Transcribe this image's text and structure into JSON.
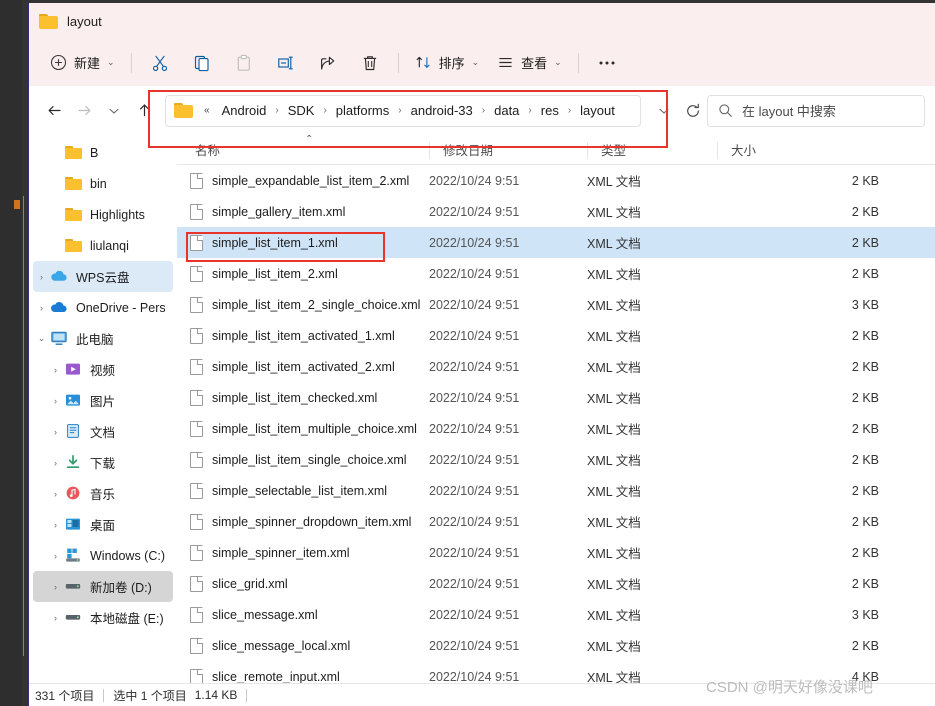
{
  "window": {
    "title": "layout",
    "folder_icon": "folder-icon"
  },
  "toolbar": {
    "new_label": "新建",
    "sort_label": "排序",
    "view_label": "查看",
    "more_label": "…",
    "icons": [
      {
        "name": "cut-icon",
        "label": "剪切"
      },
      {
        "name": "copy-icon",
        "label": "复制"
      },
      {
        "name": "paste-icon",
        "label": "粘贴"
      },
      {
        "name": "rename-icon",
        "label": "重命名"
      },
      {
        "name": "share-icon",
        "label": "共享"
      },
      {
        "name": "delete-icon",
        "label": "删除"
      }
    ]
  },
  "nav": {
    "back": "back-icon",
    "forward": "forward-icon",
    "recent": "chevron-down-icon",
    "up": "up-icon",
    "refresh": "refresh-icon"
  },
  "address": {
    "overflow": "«",
    "crumbs": [
      "Android",
      "SDK",
      "platforms",
      "android-33",
      "data",
      "res",
      "layout"
    ],
    "separator": "›"
  },
  "search": {
    "placeholder": "在 layout 中搜索",
    "icon": "search-icon"
  },
  "sidebar": {
    "items": [
      {
        "label": "B",
        "icon": "folder-icon",
        "twisty": "",
        "indent": 1,
        "state": "none"
      },
      {
        "label": "bin",
        "icon": "folder-icon",
        "twisty": "",
        "indent": 1,
        "state": "none"
      },
      {
        "label": "Highlights",
        "icon": "folder-icon",
        "twisty": "",
        "indent": 1,
        "state": "none"
      },
      {
        "label": "liulanqi",
        "icon": "folder-icon",
        "twisty": "",
        "indent": 1,
        "state": "none"
      },
      {
        "label": "WPS云盘",
        "icon": "wps-cloud-icon",
        "twisty": "›",
        "indent": 0,
        "state": "blue"
      },
      {
        "label": "OneDrive - Pers",
        "icon": "onedrive-icon",
        "twisty": "›",
        "indent": 0,
        "state": "none"
      },
      {
        "label": "此电脑",
        "icon": "this-pc-icon",
        "twisty": "⌄",
        "indent": 0,
        "state": "none"
      },
      {
        "label": "视频",
        "icon": "videos-icon",
        "twisty": "›",
        "indent": 1,
        "state": "none"
      },
      {
        "label": "图片",
        "icon": "pictures-icon",
        "twisty": "›",
        "indent": 1,
        "state": "none"
      },
      {
        "label": "文档",
        "icon": "documents-icon",
        "twisty": "›",
        "indent": 1,
        "state": "none"
      },
      {
        "label": "下载",
        "icon": "downloads-icon",
        "twisty": "›",
        "indent": 1,
        "state": "none"
      },
      {
        "label": "音乐",
        "icon": "music-icon",
        "twisty": "›",
        "indent": 1,
        "state": "none"
      },
      {
        "label": "桌面",
        "icon": "desktop-icon",
        "twisty": "›",
        "indent": 1,
        "state": "none"
      },
      {
        "label": "Windows (C:)",
        "icon": "windows-drive-icon",
        "twisty": "›",
        "indent": 1,
        "state": "none"
      },
      {
        "label": "新加卷 (D:)",
        "icon": "drive-icon",
        "twisty": "›",
        "indent": 1,
        "state": "gray"
      },
      {
        "label": "本地磁盘 (E:)",
        "icon": "drive-icon",
        "twisty": "›",
        "indent": 1,
        "state": "none"
      }
    ]
  },
  "filelist": {
    "columns": [
      "名称",
      "修改日期",
      "类型",
      "大小"
    ],
    "sort_indicator": "⌃",
    "rows": [
      {
        "name": "simple_expandable_list_item_2.xml",
        "date": "2022/10/24 9:51",
        "type": "XML 文档",
        "size": "2 KB",
        "selected": false
      },
      {
        "name": "simple_gallery_item.xml",
        "date": "2022/10/24 9:51",
        "type": "XML 文档",
        "size": "2 KB",
        "selected": false
      },
      {
        "name": "simple_list_item_1.xml",
        "date": "2022/10/24 9:51",
        "type": "XML 文档",
        "size": "2 KB",
        "selected": true
      },
      {
        "name": "simple_list_item_2.xml",
        "date": "2022/10/24 9:51",
        "type": "XML 文档",
        "size": "2 KB",
        "selected": false
      },
      {
        "name": "simple_list_item_2_single_choice.xml",
        "date": "2022/10/24 9:51",
        "type": "XML 文档",
        "size": "3 KB",
        "selected": false
      },
      {
        "name": "simple_list_item_activated_1.xml",
        "date": "2022/10/24 9:51",
        "type": "XML 文档",
        "size": "2 KB",
        "selected": false
      },
      {
        "name": "simple_list_item_activated_2.xml",
        "date": "2022/10/24 9:51",
        "type": "XML 文档",
        "size": "2 KB",
        "selected": false
      },
      {
        "name": "simple_list_item_checked.xml",
        "date": "2022/10/24 9:51",
        "type": "XML 文档",
        "size": "2 KB",
        "selected": false
      },
      {
        "name": "simple_list_item_multiple_choice.xml",
        "date": "2022/10/24 9:51",
        "type": "XML 文档",
        "size": "2 KB",
        "selected": false
      },
      {
        "name": "simple_list_item_single_choice.xml",
        "date": "2022/10/24 9:51",
        "type": "XML 文档",
        "size": "2 KB",
        "selected": false
      },
      {
        "name": "simple_selectable_list_item.xml",
        "date": "2022/10/24 9:51",
        "type": "XML 文档",
        "size": "2 KB",
        "selected": false
      },
      {
        "name": "simple_spinner_dropdown_item.xml",
        "date": "2022/10/24 9:51",
        "type": "XML 文档",
        "size": "2 KB",
        "selected": false
      },
      {
        "name": "simple_spinner_item.xml",
        "date": "2022/10/24 9:51",
        "type": "XML 文档",
        "size": "2 KB",
        "selected": false
      },
      {
        "name": "slice_grid.xml",
        "date": "2022/10/24 9:51",
        "type": "XML 文档",
        "size": "2 KB",
        "selected": false
      },
      {
        "name": "slice_message.xml",
        "date": "2022/10/24 9:51",
        "type": "XML 文档",
        "size": "3 KB",
        "selected": false
      },
      {
        "name": "slice_message_local.xml",
        "date": "2022/10/24 9:51",
        "type": "XML 文档",
        "size": "2 KB",
        "selected": false
      },
      {
        "name": "slice_remote_input.xml",
        "date": "2022/10/24 9:51",
        "type": "XML 文档",
        "size": "4 KB",
        "selected": false
      }
    ]
  },
  "statusbar": {
    "item_count": "331 个项目",
    "selection": "选中 1 个项目",
    "selection_size": "1.14 KB"
  },
  "annotations": {
    "watermark": "CSDN @明天好像没课吧",
    "highlight_color": "#e8342a"
  }
}
